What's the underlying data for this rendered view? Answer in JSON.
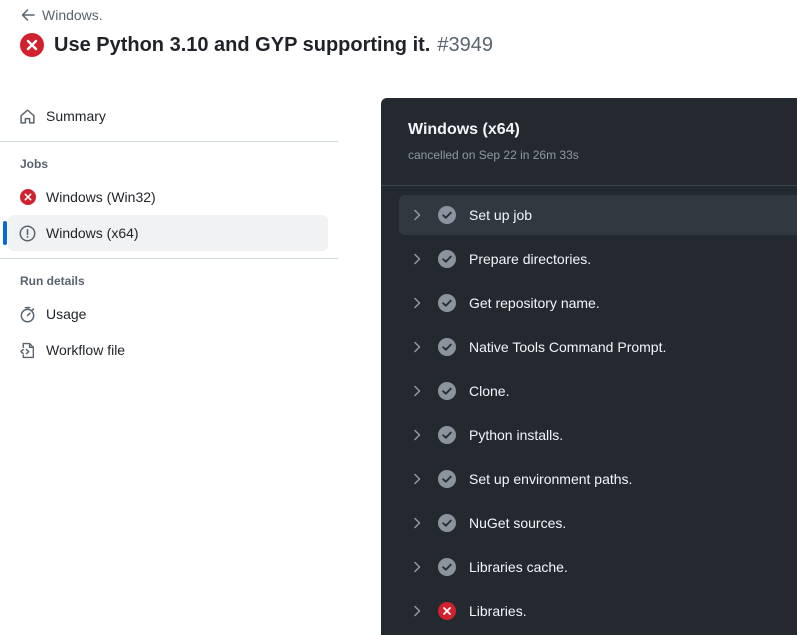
{
  "header": {
    "back_label": "Windows.",
    "title": "Use Python 3.10 and GYP supporting it.",
    "run_number": "#3949",
    "status": "failure"
  },
  "sidebar": {
    "summary_label": "Summary",
    "jobs_heading": "Jobs",
    "jobs": [
      {
        "label": "Windows (Win32)",
        "status": "failure",
        "icon": "x-circle-icon"
      },
      {
        "label": "Windows (x64)",
        "status": "cancelled",
        "icon": "alert-circle-icon",
        "selected": true
      }
    ],
    "run_details_heading": "Run details",
    "usage_label": "Usage",
    "workflow_file_label": "Workflow file"
  },
  "job": {
    "title": "Windows (x64)",
    "subtitle": "cancelled on Sep 22 in 26m 33s",
    "steps": [
      {
        "label": "Set up job",
        "status": "success"
      },
      {
        "label": "Prepare directories.",
        "status": "success"
      },
      {
        "label": "Get repository name.",
        "status": "success"
      },
      {
        "label": "Native Tools Command Prompt.",
        "status": "success"
      },
      {
        "label": "Clone.",
        "status": "success"
      },
      {
        "label": "Python installs.",
        "status": "success"
      },
      {
        "label": "Set up environment paths.",
        "status": "success"
      },
      {
        "label": "NuGet sources.",
        "status": "success"
      },
      {
        "label": "Libraries cache.",
        "status": "success"
      },
      {
        "label": "Libraries.",
        "status": "failure"
      }
    ]
  },
  "colors": {
    "failure": "#cf222e",
    "success_dark": "#8b949e",
    "accent": "#0969da",
    "panel_bg": "#24292f"
  }
}
